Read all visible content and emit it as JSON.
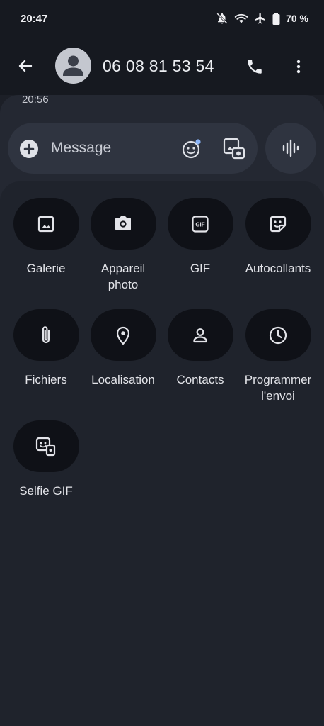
{
  "status_bar": {
    "time": "20:47",
    "battery": "70 %",
    "icons": [
      "bell-off-icon",
      "wifi-icon",
      "airplane-icon",
      "battery-icon"
    ]
  },
  "app_bar": {
    "back_icon": "arrow-back-icon",
    "contact_name": "06 08 81 53 54",
    "call_icon": "phone-icon",
    "more_icon": "more-vert-icon"
  },
  "conversation": {
    "last_time": "20:56"
  },
  "compose": {
    "placeholder": "Message",
    "add_icon": "add-circle-icon",
    "emoji_icon": "emoji-icon",
    "media_icon": "gallery-camera-icon",
    "voice_icon": "voice-wave-icon"
  },
  "attachments": [
    {
      "id": "galerie",
      "label": "Galerie",
      "icon": "image-icon"
    },
    {
      "id": "appareil-photo",
      "label": "Appareil\nphoto",
      "icon": "camera-icon"
    },
    {
      "id": "gif",
      "label": "GIF",
      "icon": "gif-icon"
    },
    {
      "id": "autocollants",
      "label": "Autocollants",
      "icon": "sticker-icon"
    },
    {
      "id": "fichiers",
      "label": "Fichiers",
      "icon": "paperclip-icon"
    },
    {
      "id": "localisation",
      "label": "Localisation",
      "icon": "location-pin-icon"
    },
    {
      "id": "contacts",
      "label": "Contacts",
      "icon": "contact-icon"
    },
    {
      "id": "programmer",
      "label": "Programmer\nl'envoi",
      "icon": "clock-icon"
    },
    {
      "id": "selfie-gif",
      "label": "Selfie GIF",
      "icon": "selfie-gif-icon"
    }
  ],
  "colors": {
    "background": "#1c1f27",
    "panel": "#1f232c",
    "field": "#2f3440",
    "button": "#0f1117",
    "accent_dot": "#8ab4f8"
  }
}
